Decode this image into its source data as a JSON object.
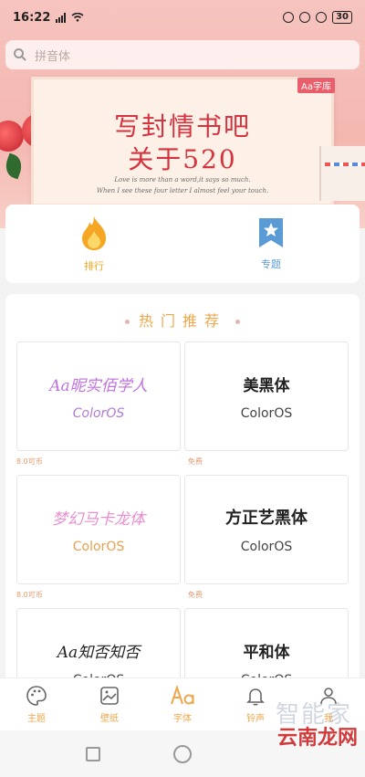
{
  "status_bar": {
    "time": "16:22",
    "battery": "30"
  },
  "search": {
    "placeholder": "拼音体"
  },
  "banner": {
    "logo": "Aa字库",
    "title_line1": "写封情书吧",
    "title_line2": "关于520",
    "sub_line1": "Love is more than a word,it says so much.",
    "sub_line2": "When I see these four letter I almost feel your touch."
  },
  "categories": [
    {
      "label": "排行",
      "icon": "flame-icon",
      "color": "#f5a623"
    },
    {
      "label": "专题",
      "icon": "bookmark-star-icon",
      "color": "#5b9bd5"
    }
  ],
  "hot": {
    "title": "热门推荐"
  },
  "fonts": [
    {
      "name": "Aa昵实佰学人",
      "brand": "ColorOS",
      "price": "8.0可币"
    },
    {
      "name": "美黑体",
      "brand": "ColorOS",
      "price": "免费"
    },
    {
      "name": "梦幻马卡龙体",
      "brand": "ColorOS",
      "price": "8.0可币"
    },
    {
      "name": "方正艺黑体",
      "brand": "ColorOS",
      "price": "免费"
    },
    {
      "name": "Aa知否知否",
      "brand": "ColorOS",
      "price": ""
    },
    {
      "name": "平和体",
      "brand": "ColorOS",
      "price": ""
    }
  ],
  "nav": [
    {
      "label": "主题",
      "icon": "palette-icon",
      "active": false
    },
    {
      "label": "壁纸",
      "icon": "image-icon",
      "active": false
    },
    {
      "label": "字体",
      "icon": "font-aa-icon",
      "active": true
    },
    {
      "label": "铃声",
      "icon": "bell-icon",
      "active": false
    },
    {
      "label": "我",
      "icon": "user-icon",
      "active": false
    }
  ],
  "watermark": {
    "line1": "智能家",
    "line2": "云南龙网"
  },
  "colors": {
    "accent": "#f0a64a",
    "pink_bg": "#f4b7b0",
    "price": "#e39a6e"
  }
}
